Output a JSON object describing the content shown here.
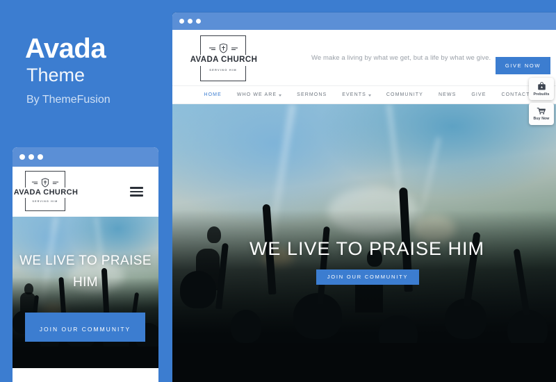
{
  "promo": {
    "title": "Avada",
    "subtitle": "Theme",
    "byline": "By ThemeFusion"
  },
  "colors": {
    "brand_blue": "#3c7dd0",
    "chrome_blue": "#5b8fd6",
    "nav_text": "#6f7780",
    "logo_dark": "#2b3038"
  },
  "site": {
    "logo": {
      "name": "AVADA CHURCH",
      "tagline": "SERVING HIM",
      "emblem_icon": "shield-cross-icon"
    },
    "header": {
      "tagline": "We make a living by what we get, but a life by what we give.",
      "cta_label": "GIVE NOW"
    },
    "nav": [
      {
        "label": "HOME",
        "active": true,
        "has_dropdown": false
      },
      {
        "label": "WHO WE ARE",
        "active": false,
        "has_dropdown": true
      },
      {
        "label": "SERMONS",
        "active": false,
        "has_dropdown": false
      },
      {
        "label": "EVENTS",
        "active": false,
        "has_dropdown": true
      },
      {
        "label": "COMMUNITY",
        "active": false,
        "has_dropdown": false
      },
      {
        "label": "NEWS",
        "active": false,
        "has_dropdown": false
      },
      {
        "label": "GIVE",
        "active": false,
        "has_dropdown": false
      },
      {
        "label": "CONTACT",
        "active": false,
        "has_dropdown": false
      }
    ],
    "hero": {
      "title": "WE LIVE TO PRAISE HIM",
      "button_label": "JOIN OUR COMMUNITY"
    }
  },
  "mobile": {
    "menu_icon": "hamburger-icon"
  },
  "floating_buttons": [
    {
      "label": "Prebuilts",
      "icon": "prebuilts-box-icon"
    },
    {
      "label": "Buy Now",
      "icon": "shopping-cart-icon"
    }
  ],
  "window_controls": {
    "dots": [
      "dot-1",
      "dot-2",
      "dot-3"
    ]
  }
}
